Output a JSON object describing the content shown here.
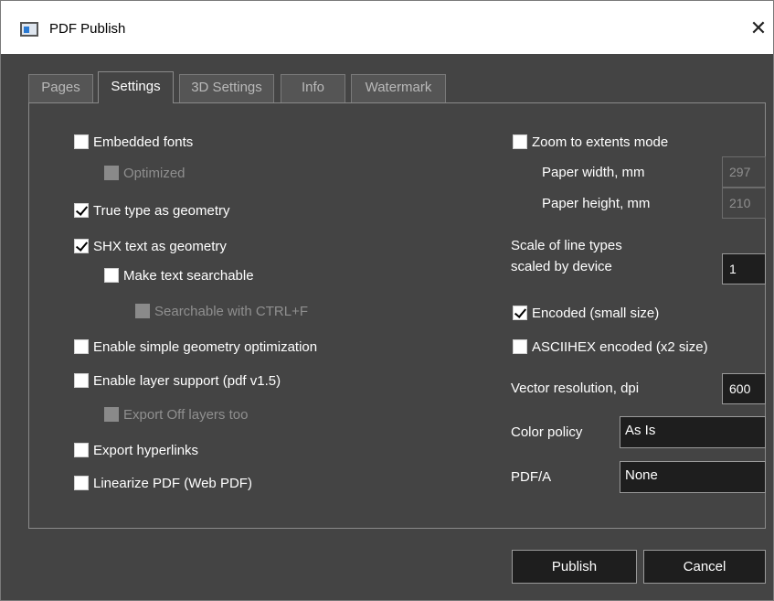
{
  "window": {
    "title": "PDF Publish",
    "close_glyph": "✕"
  },
  "tabs": [
    {
      "label": "Pages",
      "active": false
    },
    {
      "label": "Settings",
      "active": true
    },
    {
      "label": "3D Settings",
      "active": false
    },
    {
      "label": "Info",
      "active": false
    },
    {
      "label": "Watermark",
      "active": false
    }
  ],
  "left_options": {
    "embedded_fonts": {
      "label": "Embedded fonts",
      "checked": false
    },
    "optimized": {
      "label": "Optimized",
      "checked": false,
      "disabled": true
    },
    "true_type_geometry": {
      "label": "True type as geometry",
      "checked": true
    },
    "shx_text_geometry": {
      "label": "SHX text as geometry",
      "checked": true
    },
    "make_text_searchable": {
      "label": "Make text searchable",
      "checked": false
    },
    "searchable_ctrl_f": {
      "label": "Searchable with CTRL+F",
      "checked": false,
      "disabled": true
    },
    "simple_geometry_opt": {
      "label": "Enable simple geometry optimization",
      "checked": false
    },
    "layer_support": {
      "label": "Enable layer support (pdf v1.5)",
      "checked": false
    },
    "export_off_layers": {
      "label": "Export Off layers too",
      "checked": false,
      "disabled": true
    },
    "export_hyperlinks": {
      "label": "Export hyperlinks",
      "checked": false
    },
    "linearize_pdf": {
      "label": "Linearize PDF (Web PDF)",
      "checked": false
    }
  },
  "right_options": {
    "zoom_extents": {
      "label": "Zoom to extents mode",
      "checked": false
    },
    "paper_width": {
      "label": "Paper width, mm",
      "value": "297"
    },
    "paper_height": {
      "label": "Paper height, mm",
      "value": "210"
    },
    "line_type_scale": {
      "label_line1": "Scale of line types",
      "label_line2": "scaled by device",
      "value": "1"
    },
    "encoded_small": {
      "label": "Encoded (small size)",
      "checked": true
    },
    "asciihex": {
      "label": "ASCIIHEX encoded (x2 size)",
      "checked": false
    },
    "vector_resolution": {
      "label": "Vector resolution, dpi",
      "value": "600"
    },
    "color_policy": {
      "label": "Color policy",
      "value": "As Is"
    },
    "pdfa": {
      "label": "PDF/A",
      "value": "None"
    }
  },
  "buttons": {
    "publish": "Publish",
    "cancel": "Cancel"
  }
}
